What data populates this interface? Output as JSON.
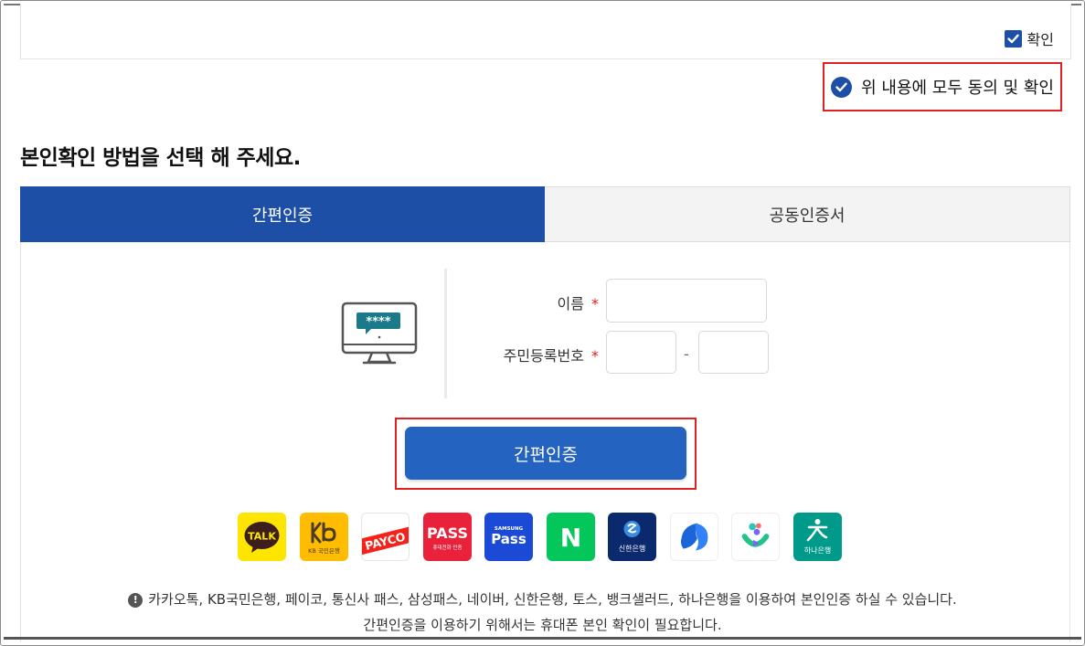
{
  "agreement": {
    "confirm_label": "확인",
    "agree_all_label": "위 내용에 모두 동의 및 확인"
  },
  "section_title": "본인확인 방법을 선택 해 주세요.",
  "tabs": [
    {
      "label": "간편인증",
      "active": true
    },
    {
      "label": "공동인증서",
      "active": false
    }
  ],
  "form": {
    "name_label": "이름",
    "rrn_label": "주민등록번호",
    "required_mark": "*",
    "rrn_separator": "-",
    "name_value": "",
    "rrn_front_value": "",
    "rrn_back_value": "",
    "monitor_password_mask": "****"
  },
  "submit_label": "간편인증",
  "providers": [
    {
      "name": "kakaotalk-logo",
      "text": "TALK",
      "bg": "#FEE500"
    },
    {
      "name": "kb-logo",
      "text": "KB 국민은행",
      "bg": "#FFBC00"
    },
    {
      "name": "payco-logo",
      "text": "PAYCO",
      "bg": "#ffffff"
    },
    {
      "name": "pass-logo",
      "text": "PASS",
      "subtext": "휴대전화 인증",
      "bg": "#E9213A"
    },
    {
      "name": "samsung-pass-logo",
      "text": "Pass",
      "subtext": "SAMSUNG",
      "bg": "#1B4BD6"
    },
    {
      "name": "naver-logo",
      "text": "N",
      "bg": "#03C75A"
    },
    {
      "name": "shinhan-logo",
      "text": "신한은행",
      "bg": "#0B2A6E"
    },
    {
      "name": "toss-logo",
      "bg": "#ffffff"
    },
    {
      "name": "banksalad-logo",
      "bg": "#ffffff"
    },
    {
      "name": "hana-logo",
      "text": "하나은행",
      "bg": "#009A8A"
    }
  ],
  "notice": {
    "line1": "카카오톡, KB국민은행, 페이코, 통신사 패스, 삼성패스, 네이버, 신한은행, 토스, 뱅크샐러드, 하나은행을 이용하여 본인인증 하실 수 있습니다.",
    "line2": "간편인증을 이용하기 위해서는 휴대폰 본인 확인이 필요합니다."
  },
  "colors": {
    "primary": "#1e4fa6",
    "button": "#2563c0",
    "highlight_border": "#e02020",
    "required": "#d62020"
  }
}
